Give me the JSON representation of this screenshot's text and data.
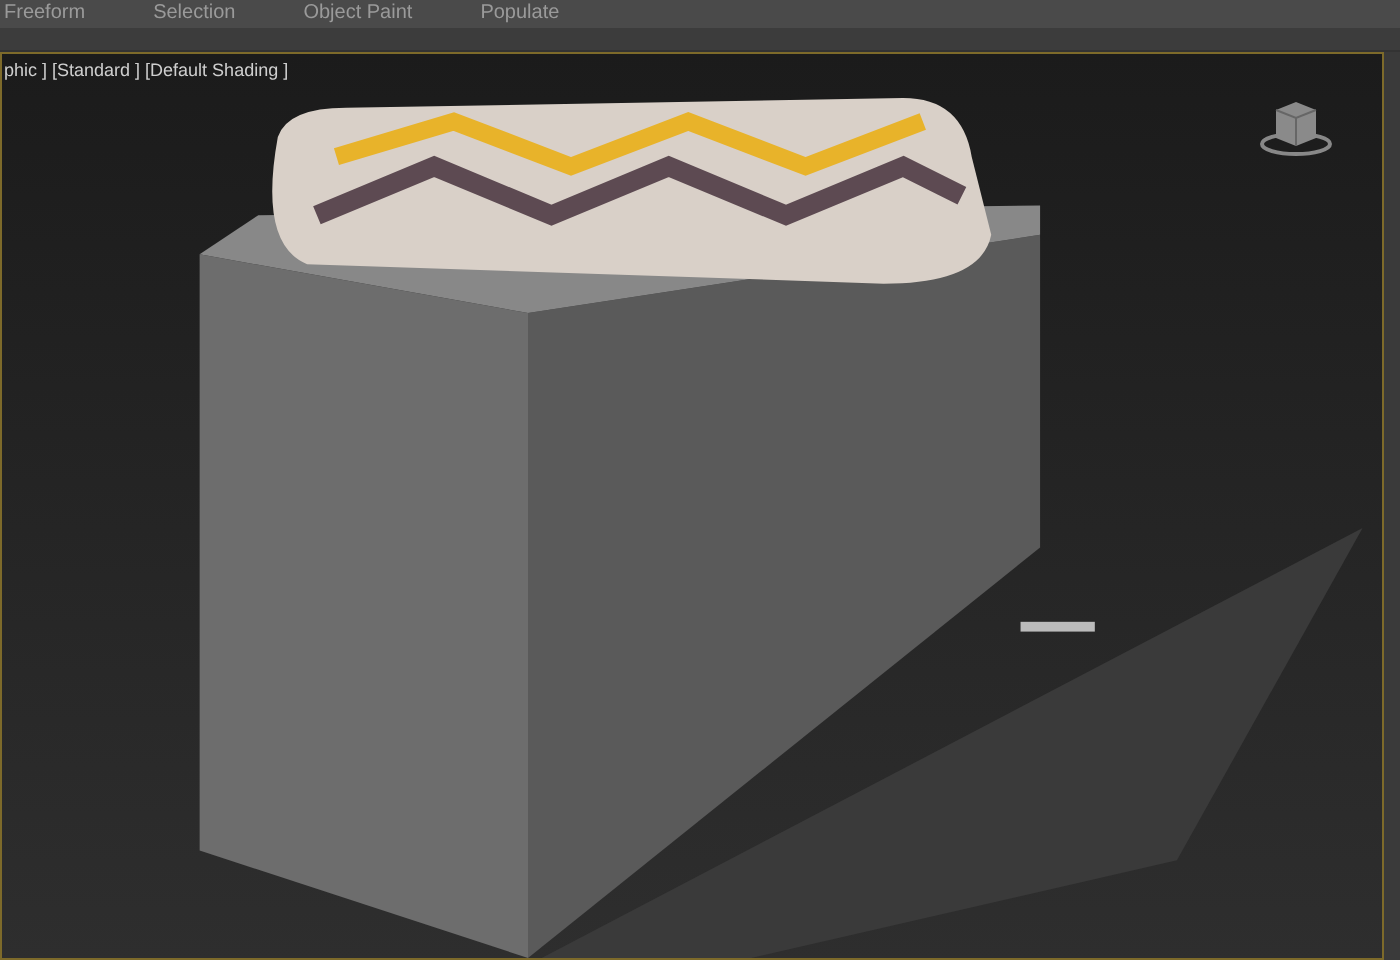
{
  "ribbon_tabs": [
    {
      "label": "Freeform",
      "selected": false
    },
    {
      "label": "Selection",
      "selected": false
    },
    {
      "label": "Object Paint",
      "selected": false
    },
    {
      "label": "Populate",
      "selected": false
    }
  ],
  "viewport": {
    "label": "phic ] [Standard ] [Default Shading ]",
    "active": true
  }
}
